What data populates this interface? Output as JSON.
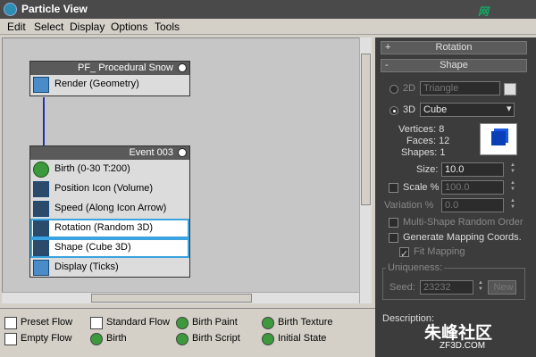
{
  "window": {
    "title": "Particle View"
  },
  "menu": [
    "Edit",
    "Select",
    "Display",
    "Options",
    "Tools"
  ],
  "global_node": {
    "title": "PF_ Procedural Snow",
    "operators": [
      {
        "label": "Render (Geometry)",
        "icon": "render-icon"
      }
    ]
  },
  "event_node": {
    "title": "Event 003",
    "operators": [
      {
        "label": "Birth  (0-30 T:200)",
        "icon": "birth-icon"
      },
      {
        "label": "Position Icon (Volume)",
        "icon": "position-icon"
      },
      {
        "label": "Speed  (Along Icon Arrow)",
        "icon": "speed-icon"
      },
      {
        "label": "Rotation  (Random 3D)",
        "icon": "rotation-icon"
      },
      {
        "label": "Shape  (Cube 3D)",
        "icon": "shape-icon"
      },
      {
        "label": "Display  (Ticks)",
        "icon": "display-icon"
      }
    ]
  },
  "panel": {
    "rollouts": {
      "rotation": "Rotation",
      "shape": "Shape",
      "rotation_sign": "+",
      "shape_sign": "-"
    },
    "mode_2d": "2D",
    "mode_3d": "3D",
    "shape_2d": "Triangle",
    "shape_3d": "Cube",
    "vertices_label": "Vertices: 8",
    "faces_label": "Faces: 12",
    "shapes_label": "Shapes: 1",
    "size_label": "Size:",
    "size_value": "10.0",
    "scale_label": "Scale %",
    "scale_value": "100.0",
    "variation_label": "Variation %",
    "variation_value": "0.0",
    "multi_shape": "Multi-Shape Random Order",
    "mapping": "Generate Mapping Coords.",
    "fit_mapping": "Fit Mapping",
    "uniqueness": "Uniqueness:",
    "seed_label": "Seed:",
    "seed_value": "23232",
    "new_button": "New",
    "description": "Description:"
  },
  "depot": [
    {
      "label": "Preset Flow",
      "icon": "preset-flow-icon"
    },
    {
      "label": "Standard Flow",
      "icon": "standard-flow-icon"
    },
    {
      "label": "Birth Paint",
      "icon": "birth-paint-icon"
    },
    {
      "label": "Birth Texture",
      "icon": "birth-texture-icon"
    },
    {
      "label": "Empty Flow",
      "icon": "empty-flow-icon"
    },
    {
      "label": "Birth",
      "icon": "birth-icon"
    },
    {
      "label": "Birth Script",
      "icon": "birth-script-icon"
    },
    {
      "label": "Initial State",
      "icon": "initial-state-icon"
    }
  ],
  "watermark": {
    "cn": "朱峰社区",
    "url": "ZF3D.COM"
  },
  "colors": {
    "selection": "#3ba3e0",
    "panel_bg": "#3c3c3c",
    "node_header": "#5a5a5a"
  }
}
